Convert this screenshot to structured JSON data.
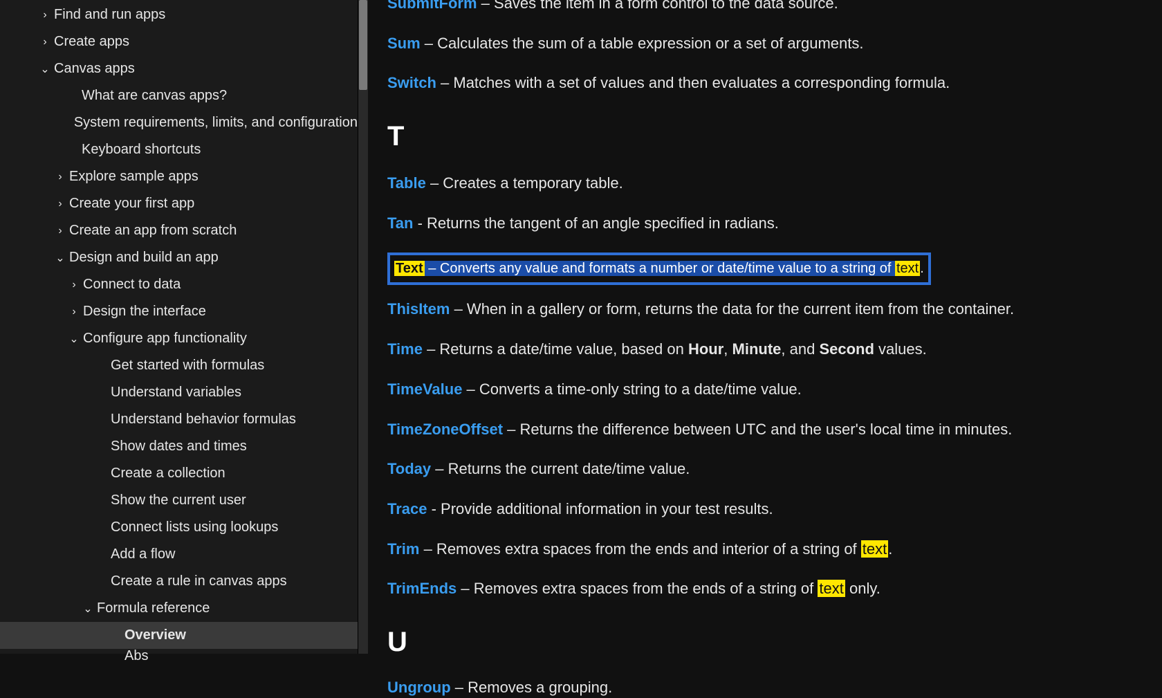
{
  "sidebar": {
    "items": [
      {
        "label": "Find and run apps",
        "indent": 58,
        "chev": "right"
      },
      {
        "label": "Create apps",
        "indent": 58,
        "chev": "right"
      },
      {
        "label": "Canvas apps",
        "indent": 58,
        "chev": "down"
      },
      {
        "label": "What are canvas apps?",
        "indent": 98,
        "chev": "none"
      },
      {
        "label": "System requirements, limits, and configuration",
        "indent": 98,
        "chev": "none"
      },
      {
        "label": "Keyboard shortcuts",
        "indent": 98,
        "chev": "none"
      },
      {
        "label": "Explore sample apps",
        "indent": 80,
        "chev": "right"
      },
      {
        "label": "Create your first app",
        "indent": 80,
        "chev": "right"
      },
      {
        "label": "Create an app from scratch",
        "indent": 80,
        "chev": "right"
      },
      {
        "label": "Design and build an app",
        "indent": 80,
        "chev": "down"
      },
      {
        "label": "Connect to data",
        "indent": 100,
        "chev": "right"
      },
      {
        "label": "Design the interface",
        "indent": 100,
        "chev": "right"
      },
      {
        "label": "Configure app functionality",
        "indent": 100,
        "chev": "down"
      },
      {
        "label": "Get started with formulas",
        "indent": 140,
        "chev": "none"
      },
      {
        "label": "Understand variables",
        "indent": 140,
        "chev": "none"
      },
      {
        "label": "Understand behavior formulas",
        "indent": 140,
        "chev": "none"
      },
      {
        "label": "Show dates and times",
        "indent": 140,
        "chev": "none"
      },
      {
        "label": "Create a collection",
        "indent": 140,
        "chev": "none"
      },
      {
        "label": "Show the current user",
        "indent": 140,
        "chev": "none"
      },
      {
        "label": "Connect lists using lookups",
        "indent": 140,
        "chev": "none"
      },
      {
        "label": "Add a flow",
        "indent": 140,
        "chev": "none"
      },
      {
        "label": "Create a rule in canvas apps",
        "indent": 140,
        "chev": "none"
      },
      {
        "label": "Formula reference",
        "indent": 120,
        "chev": "down"
      },
      {
        "label": "Overview",
        "indent": 160,
        "chev": "none",
        "active": true
      },
      {
        "label": "Abs",
        "indent": 160,
        "chev": "none",
        "cut": true
      }
    ]
  },
  "content": {
    "submitform": {
      "name": "SubmitForm",
      "desc": " – Saves the item in a form control to the data source."
    },
    "sum": {
      "name": "Sum",
      "desc": " – Calculates the sum of a table expression or a set of arguments."
    },
    "switch": {
      "name": "Switch",
      "desc": " – Matches with a set of values and then evaluates a corresponding formula."
    },
    "section_t": "T",
    "table": {
      "name": "Table",
      "desc": " – Creates a temporary table."
    },
    "tan": {
      "name": "Tan",
      "desc": " - Returns the tangent of an angle specified in radians."
    },
    "text": {
      "name": "Text",
      "desc_sel": " – Converts any value and formats a number or date/time value to a string of ",
      "hl": "text",
      "tail": "."
    },
    "thisitem": {
      "name": "ThisItem",
      "desc": " – When in a gallery or form, returns the data for the current item from the container."
    },
    "time": {
      "name": "Time",
      "pre": " – Returns a date/time value, based on ",
      "b1": "Hour",
      "c1": ", ",
      "b2": "Minute",
      "c2": ", and ",
      "b3": "Second",
      "post": " values."
    },
    "timevalue": {
      "name": "TimeValue",
      "desc": " – Converts a time-only string to a date/time value."
    },
    "tzoffset": {
      "name": "TimeZoneOffset",
      "desc": " – Returns the difference between UTC and the user's local time in minutes."
    },
    "today": {
      "name": "Today",
      "desc": " – Returns the current date/time value."
    },
    "trace": {
      "name": "Trace",
      "desc": " - Provide additional information in your test results."
    },
    "trim": {
      "name": "Trim",
      "pre": " – Removes extra spaces from the ends and interior of a string of ",
      "hl": "text",
      "post": "."
    },
    "trimends": {
      "name": "TrimEnds",
      "pre": " – Removes extra spaces from the ends of a string of ",
      "hl": "text",
      "post": " only."
    },
    "section_u": "U",
    "ungroup": {
      "name": "Ungroup",
      "desc": " – Removes a grouping."
    }
  }
}
